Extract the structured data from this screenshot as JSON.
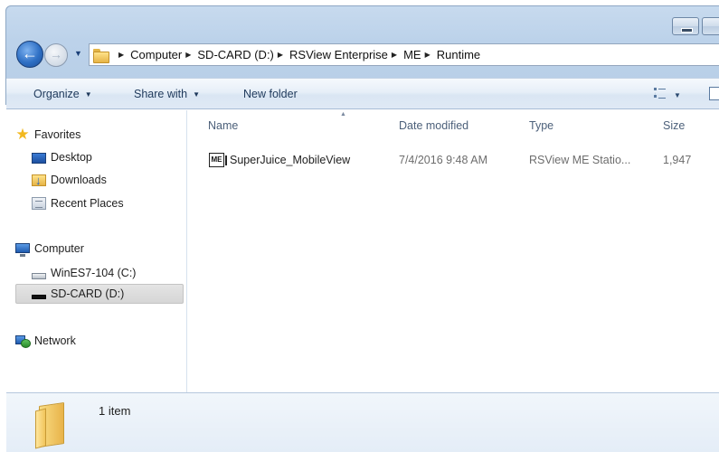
{
  "breadcrumb": [
    "Computer",
    "SD-CARD (D:)",
    "RSView Enterprise",
    "ME",
    "Runtime"
  ],
  "toolbar": {
    "organize": "Organize",
    "share_with": "Share with",
    "new_folder": "New folder"
  },
  "sidebar": {
    "favorites": {
      "label": "Favorites",
      "items": [
        {
          "label": "Desktop",
          "icon": "desktop-icon"
        },
        {
          "label": "Downloads",
          "icon": "downloads-icon"
        },
        {
          "label": "Recent Places",
          "icon": "recent-places-icon"
        }
      ]
    },
    "computer": {
      "label": "Computer",
      "items": [
        {
          "label": "WinES7-104 (C:)",
          "icon": "drive-icon"
        },
        {
          "label": "SD-CARD (D:)",
          "icon": "removable-drive-icon",
          "selected": true
        }
      ]
    },
    "network": {
      "label": "Network"
    }
  },
  "columns": {
    "name": "Name",
    "date_modified": "Date modified",
    "type": "Type",
    "size": "Size"
  },
  "files": [
    {
      "name": "SuperJuice_MobileView",
      "date_modified": "7/4/2016 9:48 AM",
      "type": "RSView ME Statio...",
      "size": "1,947"
    }
  ],
  "status": {
    "item_count": "1 item"
  },
  "colors": {
    "accent": "#1e395b",
    "selection": "#d9d9d9",
    "chrome": "#bcd2ea"
  }
}
